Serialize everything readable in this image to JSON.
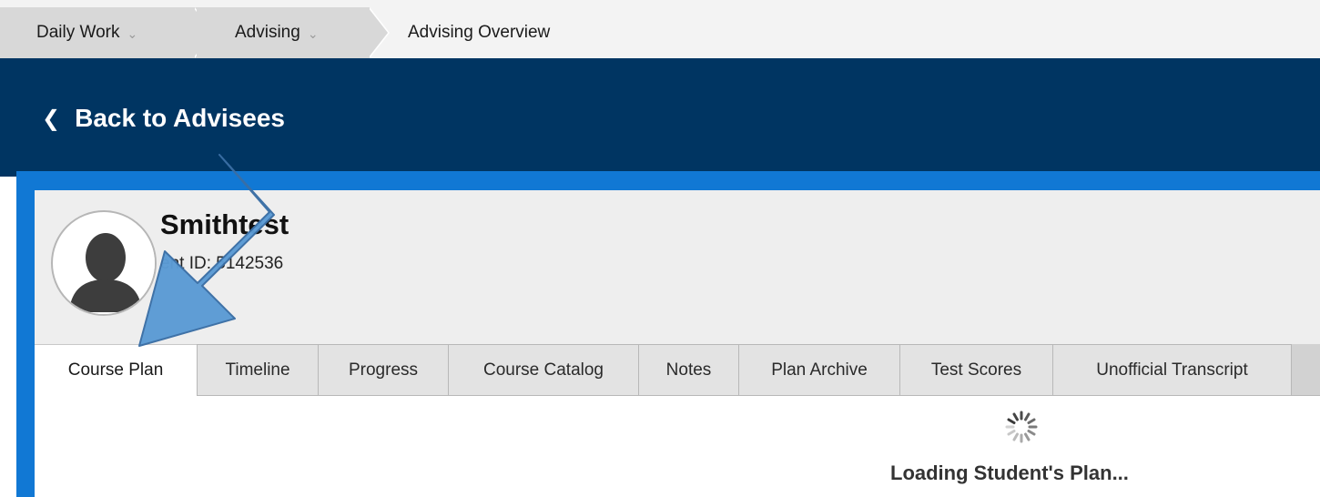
{
  "breadcrumb": {
    "items": [
      {
        "label": "Daily Work",
        "dropdown": true
      },
      {
        "label": "Advising",
        "dropdown": true
      },
      {
        "label": "Advising Overview",
        "dropdown": false
      }
    ]
  },
  "header": {
    "back_label": "Back to Advisees",
    "back_icon": "chevron-left-icon"
  },
  "student": {
    "name": "Smithtest",
    "id_text": "ent ID: 5142536",
    "avatar_icon": "person-silhouette-icon"
  },
  "tabs": [
    {
      "label": "Course Plan",
      "active": true
    },
    {
      "label": "Timeline",
      "active": false
    },
    {
      "label": "Progress",
      "active": false
    },
    {
      "label": "Course Catalog",
      "active": false
    },
    {
      "label": "Notes",
      "active": false
    },
    {
      "label": "Plan Archive",
      "active": false
    },
    {
      "label": "Test Scores",
      "active": false
    },
    {
      "label": "Unofficial Transcript",
      "active": false
    }
  ],
  "loading": {
    "text": "Loading Student's Plan...",
    "icon": "spinner-icon"
  },
  "colors": {
    "header_bg": "#003562",
    "frame_blue": "#1178d4",
    "arrow_fill": "#5b9bd5",
    "arrow_stroke": "#3a6ea5"
  }
}
